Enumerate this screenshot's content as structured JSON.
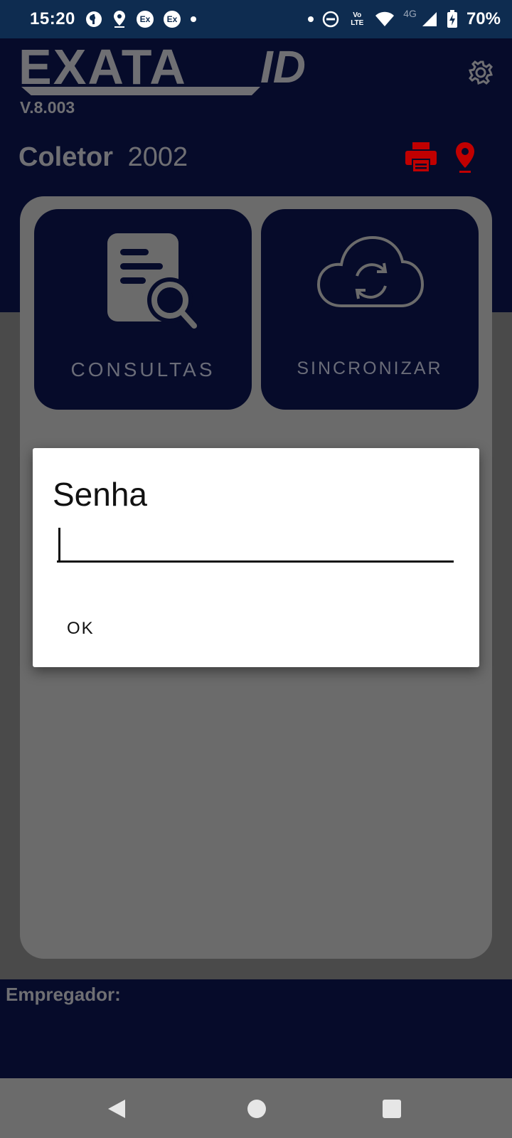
{
  "status_bar": {
    "time": "15:20",
    "battery_percent": "70%",
    "network_type": "4G",
    "left_icons": [
      "notification-icon",
      "location-icon",
      "app-ex-icon",
      "app-ex-icon",
      "more-dot-icon"
    ],
    "right_icons": [
      "dot-icon",
      "dnd-icon",
      "volte-icon",
      "wifi-icon",
      "signal-icon",
      "battery-charging-icon"
    ],
    "volte_label": "Vo LTE",
    "ex_badge": "Ex"
  },
  "header": {
    "logo_text": "EXATA",
    "logo_suffix": "ID",
    "version": "V.8.003",
    "coletor_label": "Coletor",
    "coletor_value": "2002",
    "accent_color": "#c00000"
  },
  "tiles": [
    {
      "label": "CONSULTAS",
      "icon": "document-search-icon"
    },
    {
      "label": "SINCRONIZAR",
      "icon": "cloud-sync-icon"
    }
  ],
  "footer": {
    "empregador_label": "Empregador:"
  },
  "dialog": {
    "title": "Senha",
    "input_value": "",
    "ok_label": "OK"
  },
  "colors": {
    "navy": "#060b2a",
    "status_bar": "#0e2c50",
    "card": "#6b6b6b",
    "text_gray": "#6f6f73"
  }
}
